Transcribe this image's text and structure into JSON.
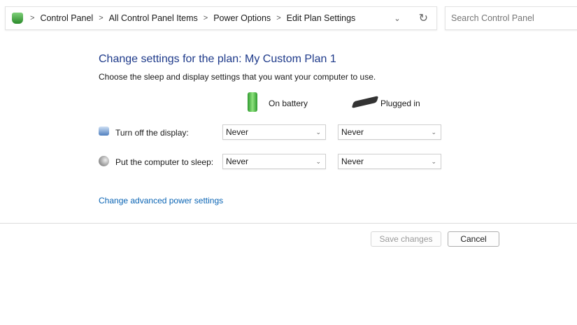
{
  "address": {
    "crumbs": [
      "Control Panel",
      "All Control Panel Items",
      "Power Options",
      "Edit Plan Settings"
    ]
  },
  "search": {
    "placeholder": "Search Control Panel"
  },
  "main": {
    "title": "Change settings for the plan: My Custom Plan 1",
    "subtitle": "Choose the sleep and display settings that you want your computer to use.",
    "col_battery": "On battery",
    "col_plugged": "Plugged in",
    "rows": [
      {
        "label": "Turn off the display:",
        "battery": "Never",
        "plugged": "Never"
      },
      {
        "label": "Put the computer to sleep:",
        "battery": "Never",
        "plugged": "Never"
      }
    ],
    "advanced_link": "Change advanced power settings"
  },
  "buttons": {
    "save": "Save changes",
    "cancel": "Cancel"
  }
}
